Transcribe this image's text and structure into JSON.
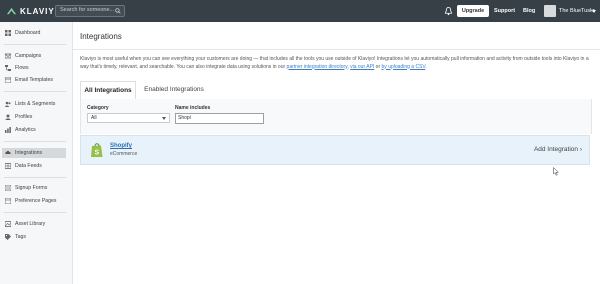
{
  "topbar": {
    "brand": "KLAVIYO",
    "search_placeholder": "Search for someone...",
    "upgrade_label": "Upgrade",
    "support_label": "Support",
    "blog_label": "Blog",
    "account_name": "The BlueTuskr",
    "accent_color": "#373f47"
  },
  "sidebar": {
    "items": [
      {
        "label": "Dashboard",
        "icon": "dashboard-icon"
      },
      {
        "label": "Campaigns",
        "icon": "campaigns-icon"
      },
      {
        "label": "Flows",
        "icon": "flows-icon"
      },
      {
        "label": "Email Templates",
        "icon": "templates-icon"
      },
      {
        "label": "Lists & Segments",
        "icon": "lists-icon"
      },
      {
        "label": "Profiles",
        "icon": "profiles-icon"
      },
      {
        "label": "Analytics",
        "icon": "analytics-icon"
      },
      {
        "label": "Integrations",
        "icon": "integrations-icon",
        "active": true
      },
      {
        "label": "Data Feeds",
        "icon": "data-feeds-icon"
      },
      {
        "label": "Signup Forms",
        "icon": "signup-forms-icon"
      },
      {
        "label": "Preference Pages",
        "icon": "preference-pages-icon"
      },
      {
        "label": "Asset Library",
        "icon": "asset-library-icon"
      },
      {
        "label": "Tags",
        "icon": "tags-icon"
      }
    ]
  },
  "main": {
    "title": "Integrations",
    "description_1": "Klaviyo is most useful when you can see everything your customers are doing — that includes all the tools you use outside of Klaviyo! Integrations let you automatically pull information and activity from outside tools into Klaviyo in a way that's timely, relevant, and searchable. You can also integrate data using solutions in our ",
    "link_directory": "partner integration directory",
    "description_2": ", ",
    "link_api": "via our API",
    "description_3": " or ",
    "link_csv": "by uploading a CSV",
    "description_4": ".",
    "tabs": [
      {
        "label": "All Integrations",
        "active": true
      },
      {
        "label": "Enabled Integrations",
        "active": false
      }
    ],
    "filters": {
      "category_label": "Category",
      "category_value": "All",
      "name_label": "Name includes",
      "name_value": "Shopi"
    },
    "results": [
      {
        "name": "Shopify",
        "category": "eCommerce",
        "action": "Add Integration ›"
      }
    ]
  }
}
